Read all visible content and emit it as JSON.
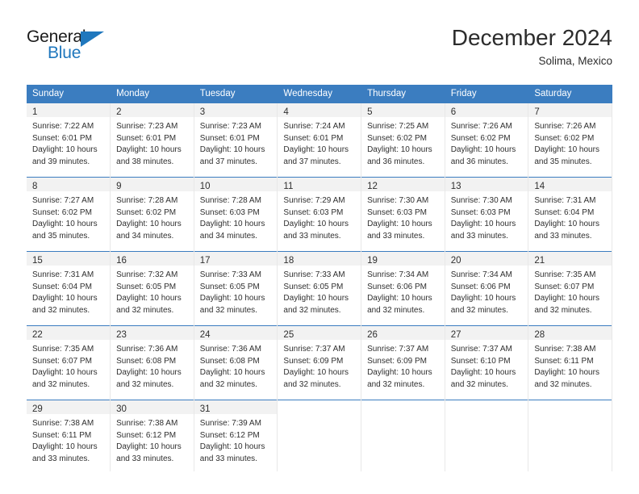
{
  "brand": {
    "name_part1": "General",
    "name_part2": "Blue",
    "triangle_icon": "triangle-icon",
    "accent_color": "#1f77bd"
  },
  "header": {
    "title": "December 2024",
    "subtitle": "Solima, Mexico"
  },
  "calendar": {
    "header_bg": "#3b7dc0",
    "header_text_color": "#ffffff",
    "daynum_bg": "#f2f2f2",
    "weekdays": [
      "Sunday",
      "Monday",
      "Tuesday",
      "Wednesday",
      "Thursday",
      "Friday",
      "Saturday"
    ],
    "weeks": [
      [
        {
          "day": "1",
          "sunrise": "Sunrise: 7:22 AM",
          "sunset": "Sunset: 6:01 PM",
          "daylight1": "Daylight: 10 hours",
          "daylight2": "and 39 minutes."
        },
        {
          "day": "2",
          "sunrise": "Sunrise: 7:23 AM",
          "sunset": "Sunset: 6:01 PM",
          "daylight1": "Daylight: 10 hours",
          "daylight2": "and 38 minutes."
        },
        {
          "day": "3",
          "sunrise": "Sunrise: 7:23 AM",
          "sunset": "Sunset: 6:01 PM",
          "daylight1": "Daylight: 10 hours",
          "daylight2": "and 37 minutes."
        },
        {
          "day": "4",
          "sunrise": "Sunrise: 7:24 AM",
          "sunset": "Sunset: 6:01 PM",
          "daylight1": "Daylight: 10 hours",
          "daylight2": "and 37 minutes."
        },
        {
          "day": "5",
          "sunrise": "Sunrise: 7:25 AM",
          "sunset": "Sunset: 6:02 PM",
          "daylight1": "Daylight: 10 hours",
          "daylight2": "and 36 minutes."
        },
        {
          "day": "6",
          "sunrise": "Sunrise: 7:26 AM",
          "sunset": "Sunset: 6:02 PM",
          "daylight1": "Daylight: 10 hours",
          "daylight2": "and 36 minutes."
        },
        {
          "day": "7",
          "sunrise": "Sunrise: 7:26 AM",
          "sunset": "Sunset: 6:02 PM",
          "daylight1": "Daylight: 10 hours",
          "daylight2": "and 35 minutes."
        }
      ],
      [
        {
          "day": "8",
          "sunrise": "Sunrise: 7:27 AM",
          "sunset": "Sunset: 6:02 PM",
          "daylight1": "Daylight: 10 hours",
          "daylight2": "and 35 minutes."
        },
        {
          "day": "9",
          "sunrise": "Sunrise: 7:28 AM",
          "sunset": "Sunset: 6:02 PM",
          "daylight1": "Daylight: 10 hours",
          "daylight2": "and 34 minutes."
        },
        {
          "day": "10",
          "sunrise": "Sunrise: 7:28 AM",
          "sunset": "Sunset: 6:03 PM",
          "daylight1": "Daylight: 10 hours",
          "daylight2": "and 34 minutes."
        },
        {
          "day": "11",
          "sunrise": "Sunrise: 7:29 AM",
          "sunset": "Sunset: 6:03 PM",
          "daylight1": "Daylight: 10 hours",
          "daylight2": "and 33 minutes."
        },
        {
          "day": "12",
          "sunrise": "Sunrise: 7:30 AM",
          "sunset": "Sunset: 6:03 PM",
          "daylight1": "Daylight: 10 hours",
          "daylight2": "and 33 minutes."
        },
        {
          "day": "13",
          "sunrise": "Sunrise: 7:30 AM",
          "sunset": "Sunset: 6:03 PM",
          "daylight1": "Daylight: 10 hours",
          "daylight2": "and 33 minutes."
        },
        {
          "day": "14",
          "sunrise": "Sunrise: 7:31 AM",
          "sunset": "Sunset: 6:04 PM",
          "daylight1": "Daylight: 10 hours",
          "daylight2": "and 33 minutes."
        }
      ],
      [
        {
          "day": "15",
          "sunrise": "Sunrise: 7:31 AM",
          "sunset": "Sunset: 6:04 PM",
          "daylight1": "Daylight: 10 hours",
          "daylight2": "and 32 minutes."
        },
        {
          "day": "16",
          "sunrise": "Sunrise: 7:32 AM",
          "sunset": "Sunset: 6:05 PM",
          "daylight1": "Daylight: 10 hours",
          "daylight2": "and 32 minutes."
        },
        {
          "day": "17",
          "sunrise": "Sunrise: 7:33 AM",
          "sunset": "Sunset: 6:05 PM",
          "daylight1": "Daylight: 10 hours",
          "daylight2": "and 32 minutes."
        },
        {
          "day": "18",
          "sunrise": "Sunrise: 7:33 AM",
          "sunset": "Sunset: 6:05 PM",
          "daylight1": "Daylight: 10 hours",
          "daylight2": "and 32 minutes."
        },
        {
          "day": "19",
          "sunrise": "Sunrise: 7:34 AM",
          "sunset": "Sunset: 6:06 PM",
          "daylight1": "Daylight: 10 hours",
          "daylight2": "and 32 minutes."
        },
        {
          "day": "20",
          "sunrise": "Sunrise: 7:34 AM",
          "sunset": "Sunset: 6:06 PM",
          "daylight1": "Daylight: 10 hours",
          "daylight2": "and 32 minutes."
        },
        {
          "day": "21",
          "sunrise": "Sunrise: 7:35 AM",
          "sunset": "Sunset: 6:07 PM",
          "daylight1": "Daylight: 10 hours",
          "daylight2": "and 32 minutes."
        }
      ],
      [
        {
          "day": "22",
          "sunrise": "Sunrise: 7:35 AM",
          "sunset": "Sunset: 6:07 PM",
          "daylight1": "Daylight: 10 hours",
          "daylight2": "and 32 minutes."
        },
        {
          "day": "23",
          "sunrise": "Sunrise: 7:36 AM",
          "sunset": "Sunset: 6:08 PM",
          "daylight1": "Daylight: 10 hours",
          "daylight2": "and 32 minutes."
        },
        {
          "day": "24",
          "sunrise": "Sunrise: 7:36 AM",
          "sunset": "Sunset: 6:08 PM",
          "daylight1": "Daylight: 10 hours",
          "daylight2": "and 32 minutes."
        },
        {
          "day": "25",
          "sunrise": "Sunrise: 7:37 AM",
          "sunset": "Sunset: 6:09 PM",
          "daylight1": "Daylight: 10 hours",
          "daylight2": "and 32 minutes."
        },
        {
          "day": "26",
          "sunrise": "Sunrise: 7:37 AM",
          "sunset": "Sunset: 6:09 PM",
          "daylight1": "Daylight: 10 hours",
          "daylight2": "and 32 minutes."
        },
        {
          "day": "27",
          "sunrise": "Sunrise: 7:37 AM",
          "sunset": "Sunset: 6:10 PM",
          "daylight1": "Daylight: 10 hours",
          "daylight2": "and 32 minutes."
        },
        {
          "day": "28",
          "sunrise": "Sunrise: 7:38 AM",
          "sunset": "Sunset: 6:11 PM",
          "daylight1": "Daylight: 10 hours",
          "daylight2": "and 32 minutes."
        }
      ],
      [
        {
          "day": "29",
          "sunrise": "Sunrise: 7:38 AM",
          "sunset": "Sunset: 6:11 PM",
          "daylight1": "Daylight: 10 hours",
          "daylight2": "and 33 minutes."
        },
        {
          "day": "30",
          "sunrise": "Sunrise: 7:38 AM",
          "sunset": "Sunset: 6:12 PM",
          "daylight1": "Daylight: 10 hours",
          "daylight2": "and 33 minutes."
        },
        {
          "day": "31",
          "sunrise": "Sunrise: 7:39 AM",
          "sunset": "Sunset: 6:12 PM",
          "daylight1": "Daylight: 10 hours",
          "daylight2": "and 33 minutes."
        },
        {
          "day": "",
          "sunrise": "",
          "sunset": "",
          "daylight1": "",
          "daylight2": ""
        },
        {
          "day": "",
          "sunrise": "",
          "sunset": "",
          "daylight1": "",
          "daylight2": ""
        },
        {
          "day": "",
          "sunrise": "",
          "sunset": "",
          "daylight1": "",
          "daylight2": ""
        },
        {
          "day": "",
          "sunrise": "",
          "sunset": "",
          "daylight1": "",
          "daylight2": ""
        }
      ]
    ]
  }
}
